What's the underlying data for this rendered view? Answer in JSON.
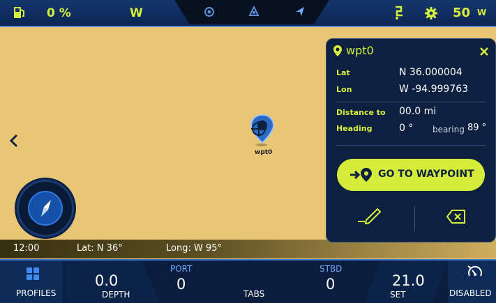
{
  "topbar": {
    "fuel_percent": "0 %",
    "heading_letter": "W",
    "speed": "50",
    "speed_unit": "W"
  },
  "map": {
    "waypoint_label": "wpt0"
  },
  "status": {
    "time": "12:00",
    "lat": "Lat: N 36°",
    "long": "Long: W 95°"
  },
  "panel": {
    "title": "wpt0",
    "lat_label": "Lat",
    "lat_value": "N 36.000004",
    "lon_label": "Lon",
    "lon_value": "W -94.999763",
    "distance_label": "Distance to",
    "distance_value": "00.0 mi",
    "heading_label": "Heading",
    "heading_value": "0 °",
    "bearing_label": "bearing",
    "bearing_value": "89 °",
    "go_button": "GO TO WAYPOINT"
  },
  "bottombar": {
    "profiles_label": "PROFILES",
    "depth_value": "0.0",
    "depth_label": "DEPTH",
    "port_label": "PORT",
    "port_value": "0",
    "tabs_label": "TABS",
    "stbd_label": "STBD",
    "stbd_value": "0",
    "set_value": "21.0",
    "set_label": "SET",
    "disabled_label": "DISABLED"
  },
  "colors": {
    "accent": "#d6f23c",
    "map": "#e9c675",
    "panel": "#0d2040",
    "topbar": "#12316a"
  }
}
